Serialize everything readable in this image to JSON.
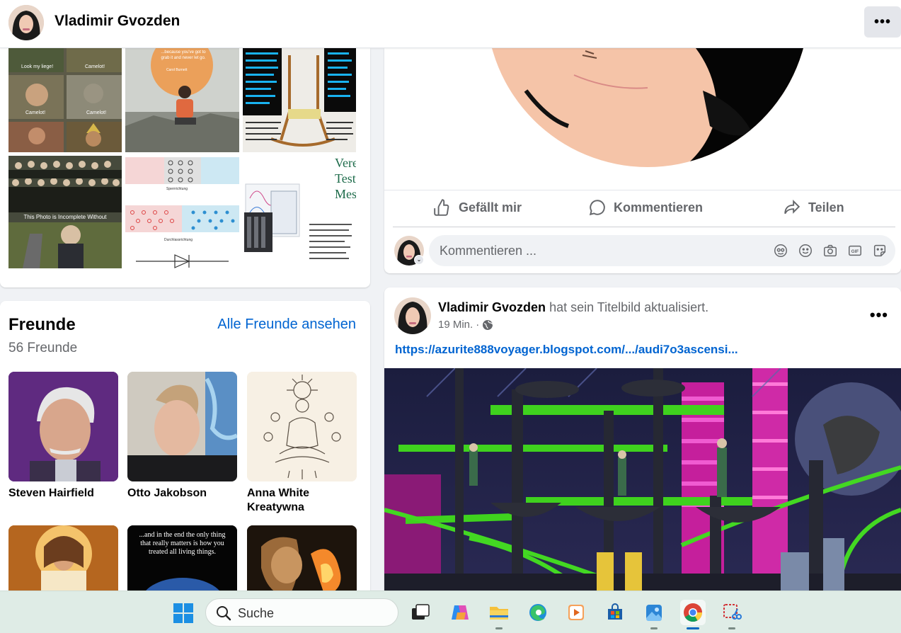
{
  "header": {
    "name": "Vladimir Gvozden",
    "more_label": "•••"
  },
  "photos": {
    "tile_captions": [
      "Look my liege!",
      "Camelot!",
      "Camelot!",
      "Camelot!",
      "This Photo is Incomplete Without",
      "Sperrrichtung",
      "Durchlassrichtung",
      "Vere",
      "Test",
      "Mes"
    ],
    "quote_text": "...because you've got to grab it and never let go.",
    "quote_author": "Carol Burnett"
  },
  "friends": {
    "title": "Freunde",
    "count": "56 Freunde",
    "see_all": "Alle Freunde ansehen",
    "list": [
      {
        "name": "Steven Hairfield"
      },
      {
        "name": "Otto Jakobson"
      },
      {
        "name": "Anna White Kreatywna"
      }
    ],
    "row2_captions": [
      "...and in the end the only thing that really matters is how you treated all living things."
    ]
  },
  "post1": {
    "like": "Gefällt mir",
    "comment": "Kommentieren",
    "share": "Teilen",
    "comment_placeholder": "Kommentieren ..."
  },
  "post2": {
    "author": "Vladimir Gvozden",
    "action": "hat sein Titelbild aktualisiert.",
    "time": "19 Min.",
    "separator": "·",
    "more_label": "•••",
    "link": "https://azurite888voyager.blogspot.com/.../audi7o3ascensi..."
  },
  "taskbar": {
    "search_label": "Suche",
    "apps": [
      "task-view",
      "copilot",
      "file-explorer",
      "edge",
      "media-player",
      "store",
      "photos",
      "chrome",
      "snipping-tool"
    ],
    "active_app": "chrome"
  },
  "colors": {
    "link_blue": "#0064d1",
    "secondary_text": "#65676b",
    "taskbar_bg": "#dfece6"
  }
}
